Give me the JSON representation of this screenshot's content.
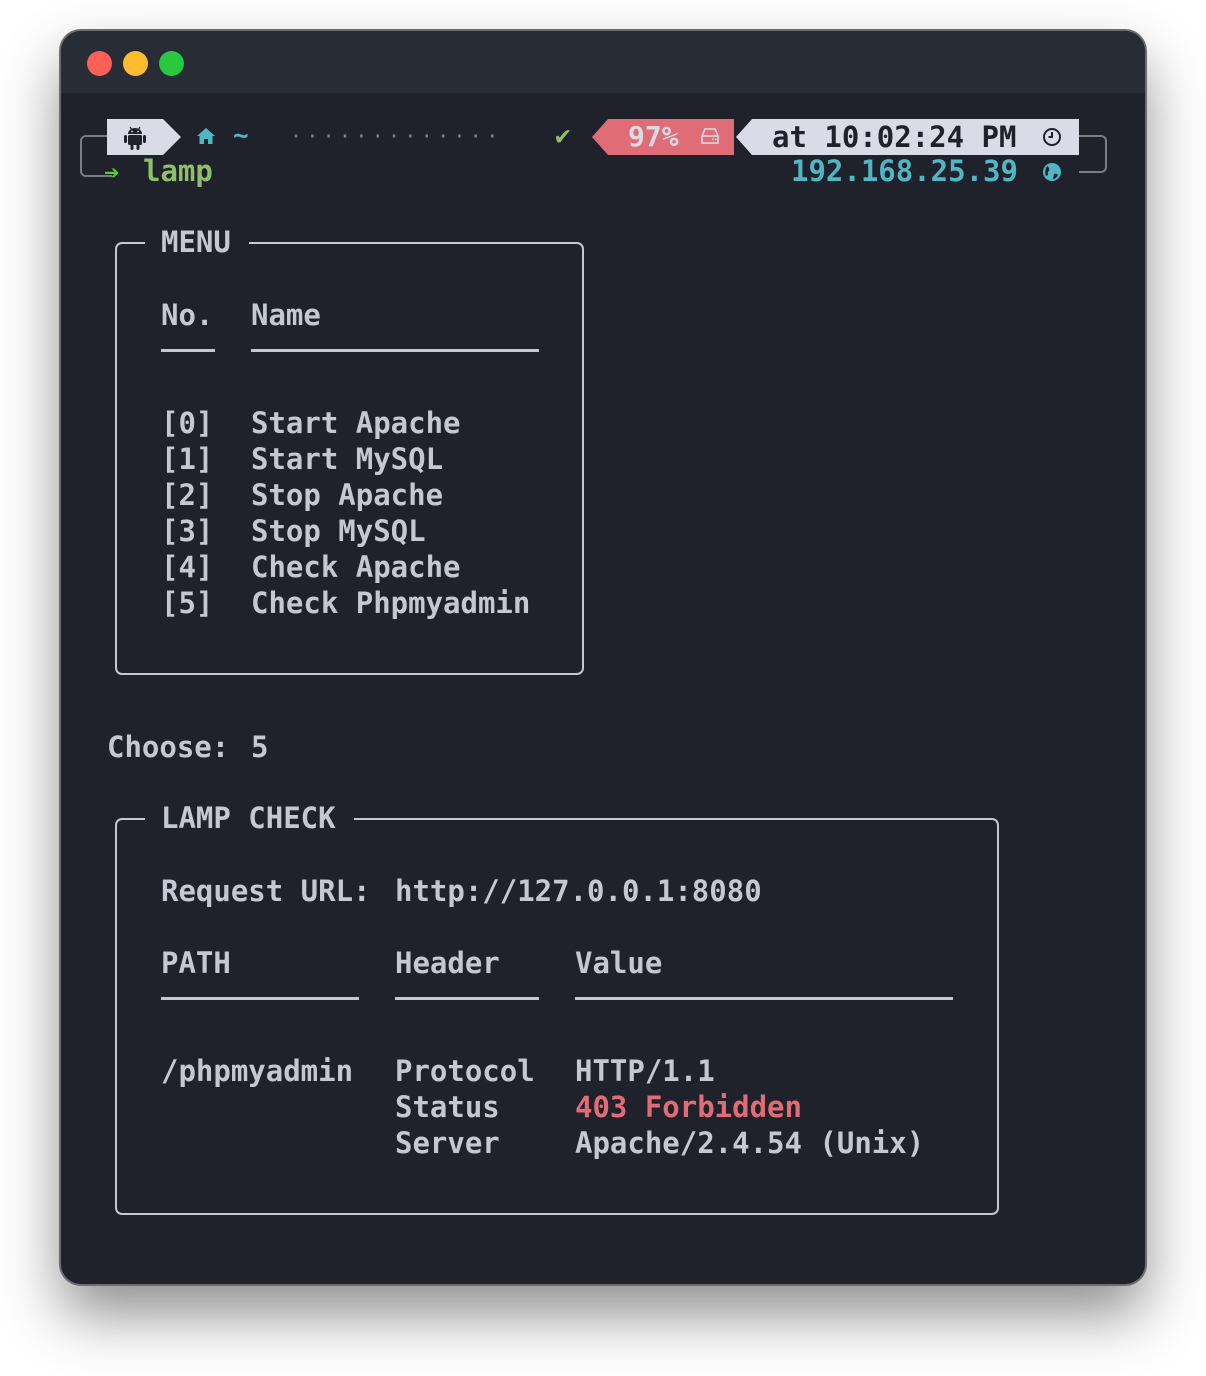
{
  "window": {
    "controls": [
      "close",
      "minimize",
      "zoom"
    ]
  },
  "prompt": {
    "os_icon": "android-icon",
    "home_icon": "home-icon",
    "path": "~",
    "filler": "·············",
    "status_icon": "check-icon",
    "status_glyph": "✔",
    "battery": "97%",
    "battery_icon": "disk-icon",
    "time": "at 10:02:24 PM",
    "time_icon": "clock-icon",
    "arrow": "➔",
    "command": "lamp",
    "ip": "192.168.25.39",
    "ip_icon": "globe-icon"
  },
  "menu": {
    "title": "MENU",
    "columns": [
      "No.",
      "Name"
    ],
    "items": [
      {
        "no": "[0]",
        "name": "Start Apache"
      },
      {
        "no": "[1]",
        "name": "Start MySQL"
      },
      {
        "no": "[2]",
        "name": "Stop Apache"
      },
      {
        "no": "[3]",
        "name": "Stop MySQL"
      },
      {
        "no": "[4]",
        "name": "Check Apache"
      },
      {
        "no": "[5]",
        "name": "Check Phpmyadmin"
      }
    ]
  },
  "choose": {
    "label": "Choose:",
    "value": "5"
  },
  "check": {
    "title": "LAMP CHECK",
    "request_label": "Request URL:",
    "request_url": "http://127.0.0.1:8080",
    "columns": [
      "PATH",
      "Header",
      "Value"
    ],
    "path": "/phpmyadmin",
    "rows": [
      {
        "header": "Protocol",
        "value": "HTTP/1.1",
        "status": "normal"
      },
      {
        "header": "Status",
        "value": "403 Forbidden",
        "status": "error"
      },
      {
        "header": "Server",
        "value": "Apache/2.4.54 (Unix)",
        "status": "normal"
      }
    ]
  },
  "colors": {
    "background": "#1f222b",
    "text": "#c5c8d2",
    "error": "#e06c75",
    "accent_cyan": "#4fb6c4",
    "accent_green": "#8fbf6a"
  }
}
